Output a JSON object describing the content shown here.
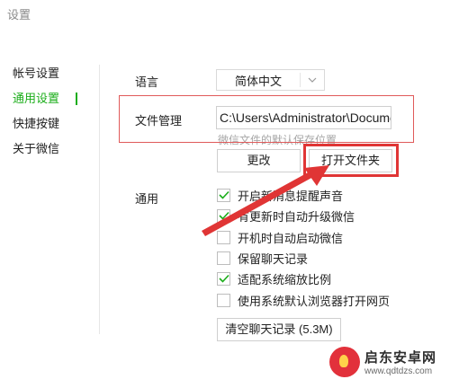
{
  "window": {
    "title": "设置"
  },
  "sidebar": {
    "items": [
      {
        "label": "帐号设置",
        "active": false
      },
      {
        "label": "通用设置",
        "active": true
      },
      {
        "label": "快捷按键",
        "active": false
      },
      {
        "label": "关于微信",
        "active": false
      }
    ]
  },
  "language": {
    "label": "语言",
    "value": "简体中文"
  },
  "file_management": {
    "label": "文件管理",
    "path": "C:\\Users\\Administrator\\Documents",
    "hint": "微信文件的默认保存位置",
    "change_label": "更改",
    "open_folder_label": "打开文件夹"
  },
  "general": {
    "label": "通用",
    "options": [
      {
        "label": "开启新消息提醒声音",
        "checked": true
      },
      {
        "label": "有更新时自动升级微信",
        "checked": true
      },
      {
        "label": "开机时自动启动微信",
        "checked": false
      },
      {
        "label": "保留聊天记录",
        "checked": false
      },
      {
        "label": "适配系统缩放比例",
        "checked": true
      },
      {
        "label": "使用系统默认浏览器打开网页",
        "checked": false
      }
    ],
    "clear_history_label": "清空聊天记录 (5.3M)"
  },
  "watermark": {
    "text": "启东安卓网",
    "url": "www.qdtdzs.com"
  },
  "colors": {
    "accent": "#1aad19",
    "highlight": "#e03535"
  }
}
